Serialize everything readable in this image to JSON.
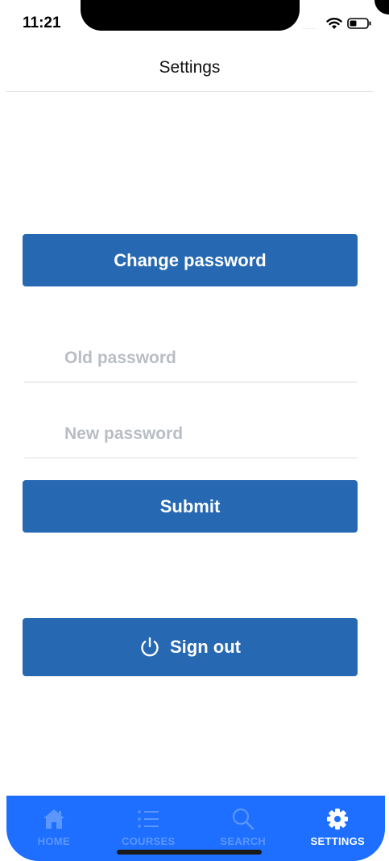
{
  "status_bar": {
    "time": "11:21",
    "signal": "....."
  },
  "header": {
    "title": "Settings"
  },
  "buttons": {
    "change_password": "Change password",
    "submit": "Submit",
    "sign_out": "Sign out"
  },
  "fields": {
    "old_password": {
      "placeholder": "Old password",
      "value": ""
    },
    "new_password": {
      "placeholder": "New password",
      "value": ""
    }
  },
  "tabbar": {
    "active": "SETTINGS",
    "tabs": [
      {
        "label": "HOME",
        "icon": "home-icon"
      },
      {
        "label": "COURSES",
        "icon": "list-icon"
      },
      {
        "label": "SEARCH",
        "icon": "search-icon"
      },
      {
        "label": "SETTINGS",
        "icon": "gear-icon"
      }
    ]
  },
  "colors": {
    "primary_button": "#2668b1",
    "tabbar_background": "#1e6fff",
    "tab_inactive": "#5b97ff",
    "tab_active": "#ffffff",
    "placeholder": "#b9bdc4"
  }
}
